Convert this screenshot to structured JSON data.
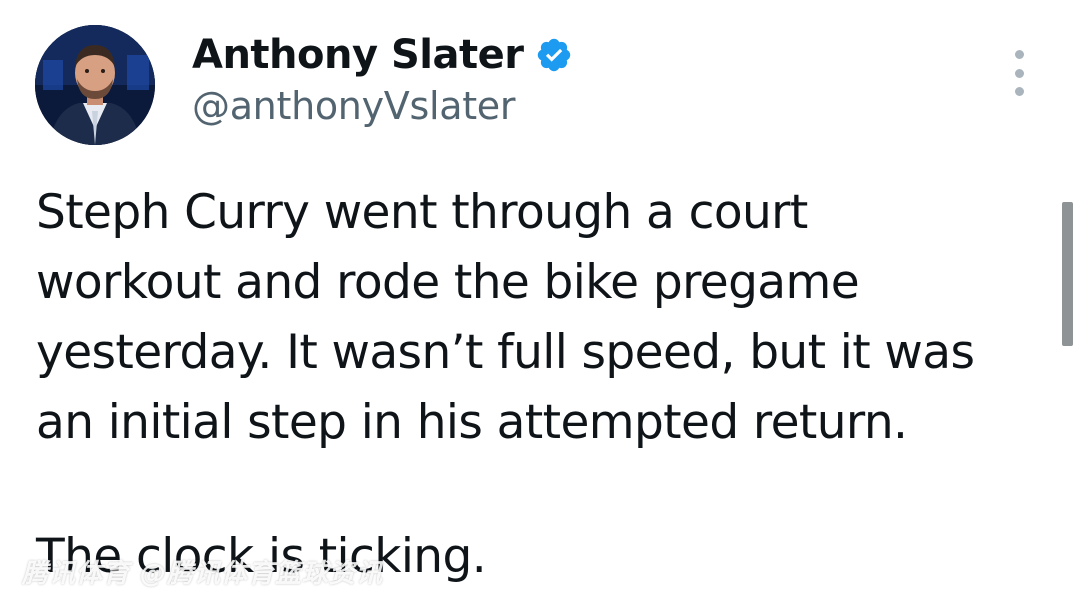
{
  "author": {
    "display_name": "Anthony Slater",
    "handle": "@anthonyVslater",
    "verified": true,
    "avatar_icon": "profile-photo"
  },
  "menu": {
    "icon": "more-vertical-icon"
  },
  "tweet": {
    "lines": [
      "Steph Curry went through a court",
      "workout and rode the bike pregame",
      "yesterday. It wasn’t full speed, but it was",
      "an initial step in his attempted return."
    ],
    "closing": "The clock is ticking."
  },
  "watermark": {
    "text": "腾讯体育 @腾讯体育篮球资讯"
  },
  "colors": {
    "text_primary": "#0f1419",
    "text_secondary": "#536471",
    "verified_blue": "#1d9bf0",
    "menu_dots": "#aab4bd"
  }
}
